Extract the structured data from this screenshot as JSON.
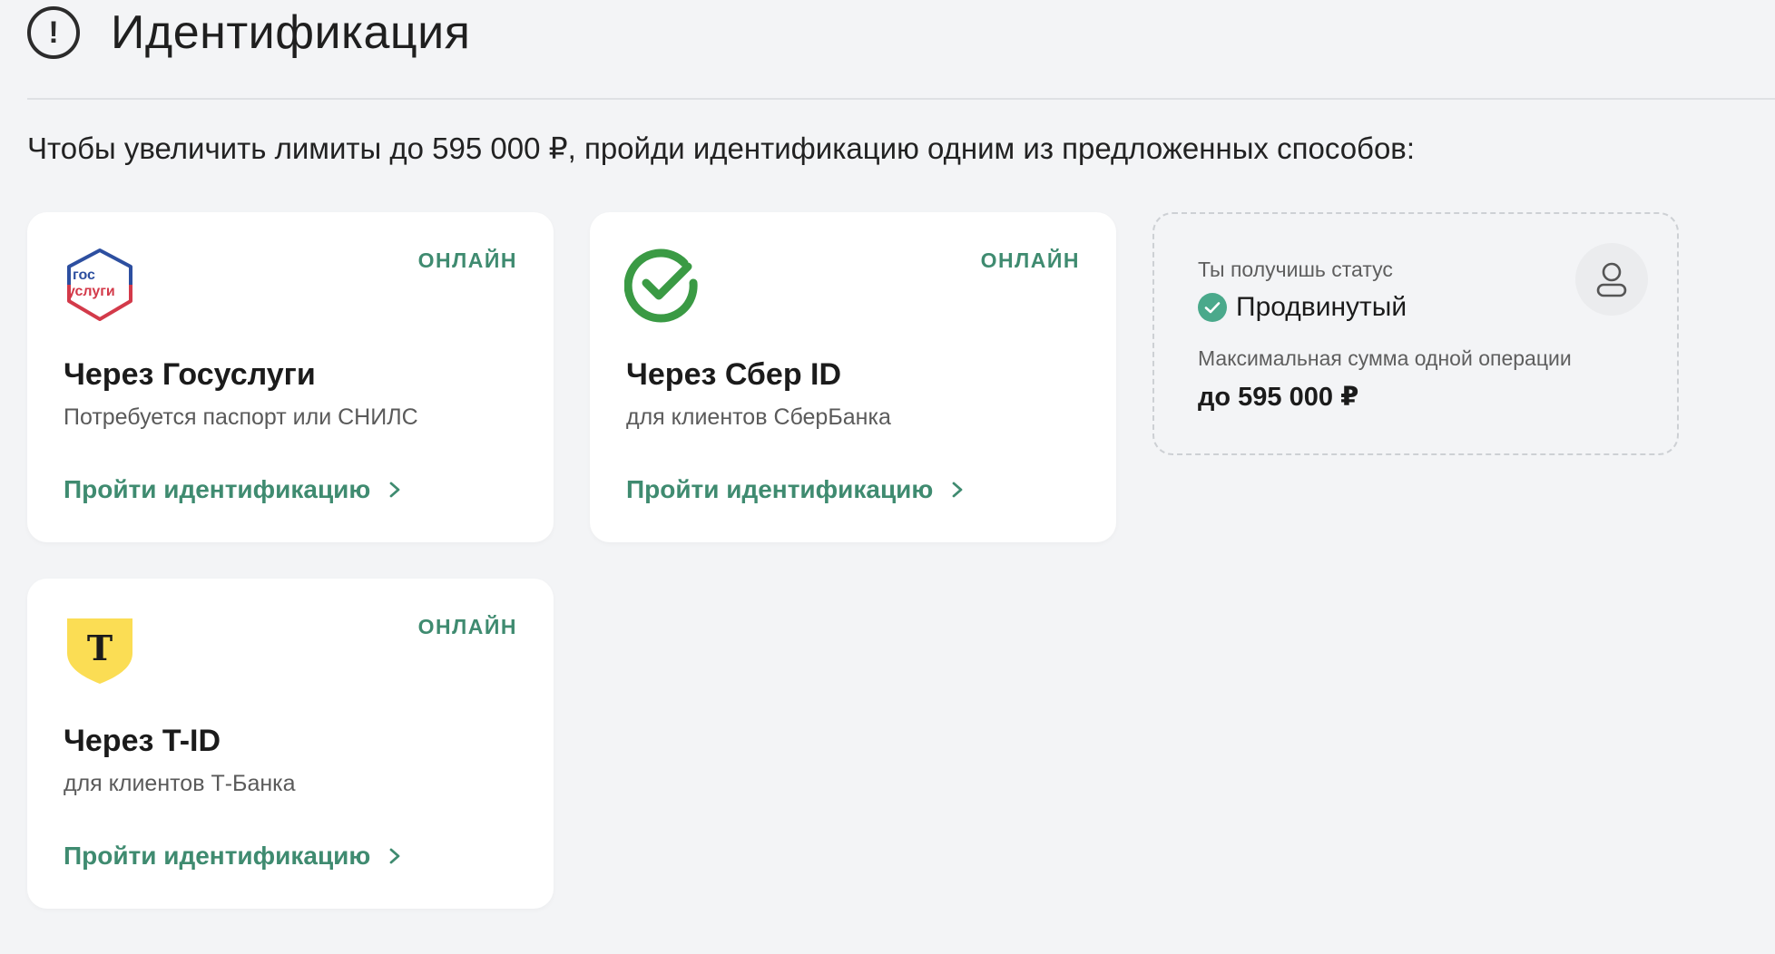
{
  "header": {
    "title": "Идентификация",
    "alert_icon": "exclamation-circle-icon"
  },
  "subtitle": "Чтобы увеличить лимиты до 595 000 ₽, пройди идентификацию одним из предложенных способов:",
  "cards": [
    {
      "id": "gosuslugi",
      "badge": "ОНЛАЙН",
      "logo": "gosuslugi-logo",
      "logo_text_1": "гос",
      "logo_text_2": "услуги",
      "title": "Через Госуслуги",
      "description": "Потребуется паспорт или СНИЛС",
      "link": "Пройти идентификацию"
    },
    {
      "id": "sber",
      "badge": "ОНЛАЙН",
      "logo": "sber-logo",
      "title": "Через Сбер ID",
      "description": "для клиентов СберБанка",
      "link": "Пройти идентификацию"
    },
    {
      "id": "tid",
      "badge": "ОНЛАЙН",
      "logo": "tbank-logo",
      "logo_text": "Т",
      "title": "Через T-ID",
      "description": "для клиентов Т-Банка",
      "link": "Пройти идентификацию"
    }
  ],
  "status_panel": {
    "label": "Ты получишь статус",
    "status": "Продвинутый",
    "max_label": "Максимальная сумма одной операции",
    "max_value": "до 595 000 ₽",
    "avatar_icon": "user-icon"
  },
  "colors": {
    "accent": "#3f8b70",
    "status_check": "#4aa98b",
    "background": "#f3f4f6",
    "gos_blue": "#2d4fa0",
    "gos_red": "#d33a4a",
    "sber_green": "#3a9a44",
    "tbank_yellow": "#fbdd54"
  }
}
